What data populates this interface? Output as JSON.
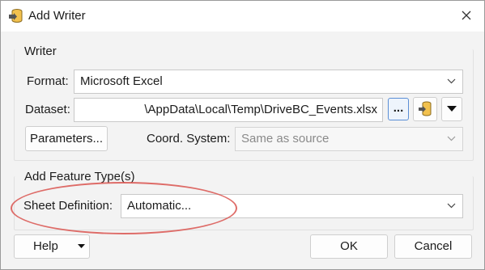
{
  "window": {
    "title": "Add Writer",
    "title_icon": "writer-db-icon",
    "close_icon": "close-icon"
  },
  "writer": {
    "group_title": "Writer",
    "format_label": "Format:",
    "format_value": "Microsoft Excel",
    "dataset_label": "Dataset:",
    "dataset_value": "\\AppData\\Local\\Temp\\DriveBC_Events.xlsx",
    "browse_label": "...",
    "parameters_label": "Parameters...",
    "coord_label": "Coord. System:",
    "coord_value": "Same as source"
  },
  "feature_type": {
    "group_title": "Add Feature Type(s)",
    "sheet_label": "Sheet Definition:",
    "sheet_value": "Automatic..."
  },
  "footer": {
    "help_label": "Help",
    "ok_label": "OK",
    "cancel_label": "Cancel"
  },
  "colors": {
    "highlight_oval": "#d9534f",
    "focus_blue": "#5b8fd6"
  }
}
